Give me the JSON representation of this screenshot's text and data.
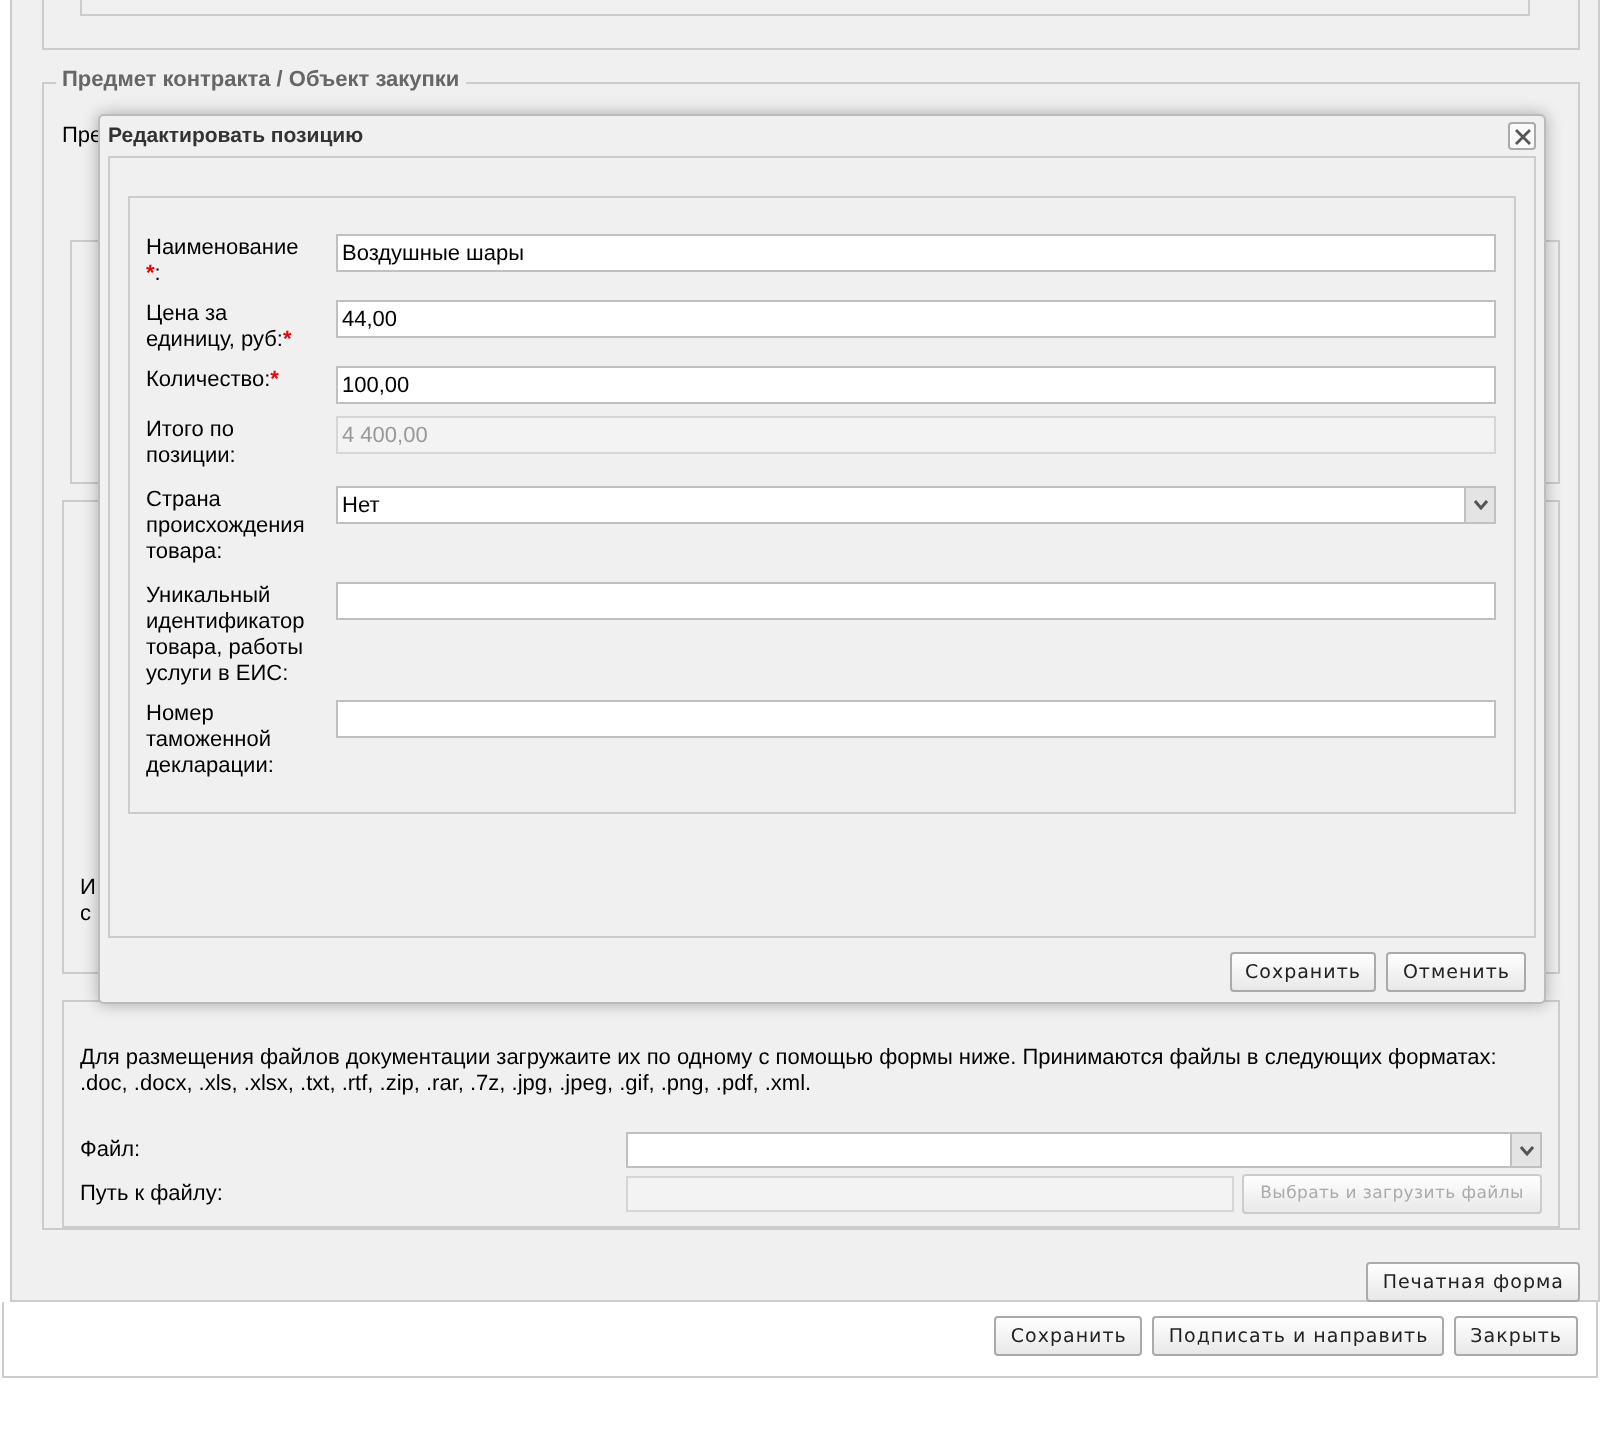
{
  "section": {
    "legend": "Предмет контракта / Объект закупки",
    "intro_fragment": "Пре",
    "note_fragments": [
      "И",
      "с"
    ]
  },
  "documents": {
    "note": "Для размещения файлов документации загружаите их по одному с помощью формы ниже. Принимаются файлы в следующих форматах:",
    "formats": ".doc, .docx, .xls, .xlsx, .txt, .rtf, .zip, .rar, .7z, .jpg, .jpeg, .gif, .png, .pdf, .xml.",
    "fields": [
      {
        "label": "Файл:",
        "kind": "select",
        "disabled": false
      },
      {
        "label": "Путь к файлу:",
        "kind": "path",
        "disabled": true,
        "button": "Выбрать и загрузить файлы"
      }
    ]
  },
  "print_button": "Печатная форма",
  "footer_buttons": [
    "Сохранить",
    "Подписать и направить",
    "Закрыть"
  ],
  "dialog": {
    "title": "Редактировать позицию",
    "fields": [
      {
        "label": "Наименование ",
        "mark": "*",
        "suffix": ":",
        "kind": "text",
        "value": "Воздушные шары",
        "disabled": false
      },
      {
        "label": "Цена за единицу, руб:",
        "mark": "*",
        "kind": "text",
        "value": "44,00",
        "disabled": false
      },
      {
        "label": "Количество:",
        "mark": "*",
        "kind": "text",
        "value": "100,00",
        "disabled": false
      },
      {
        "label": "Итого по позиции:",
        "kind": "text",
        "value": "4 400,00",
        "disabled": true
      },
      {
        "label": "Страна происхождения товара:",
        "kind": "select",
        "value": "Нет",
        "disabled": false
      },
      {
        "label": "Уникальный идентификатор товара, работы услуги в ЕИС:",
        "kind": "text",
        "disabled": false
      },
      {
        "label": "Номер таможенной декларации:",
        "kind": "text",
        "disabled": false
      }
    ],
    "buttons": [
      "Сохранить",
      "Отменить"
    ]
  }
}
